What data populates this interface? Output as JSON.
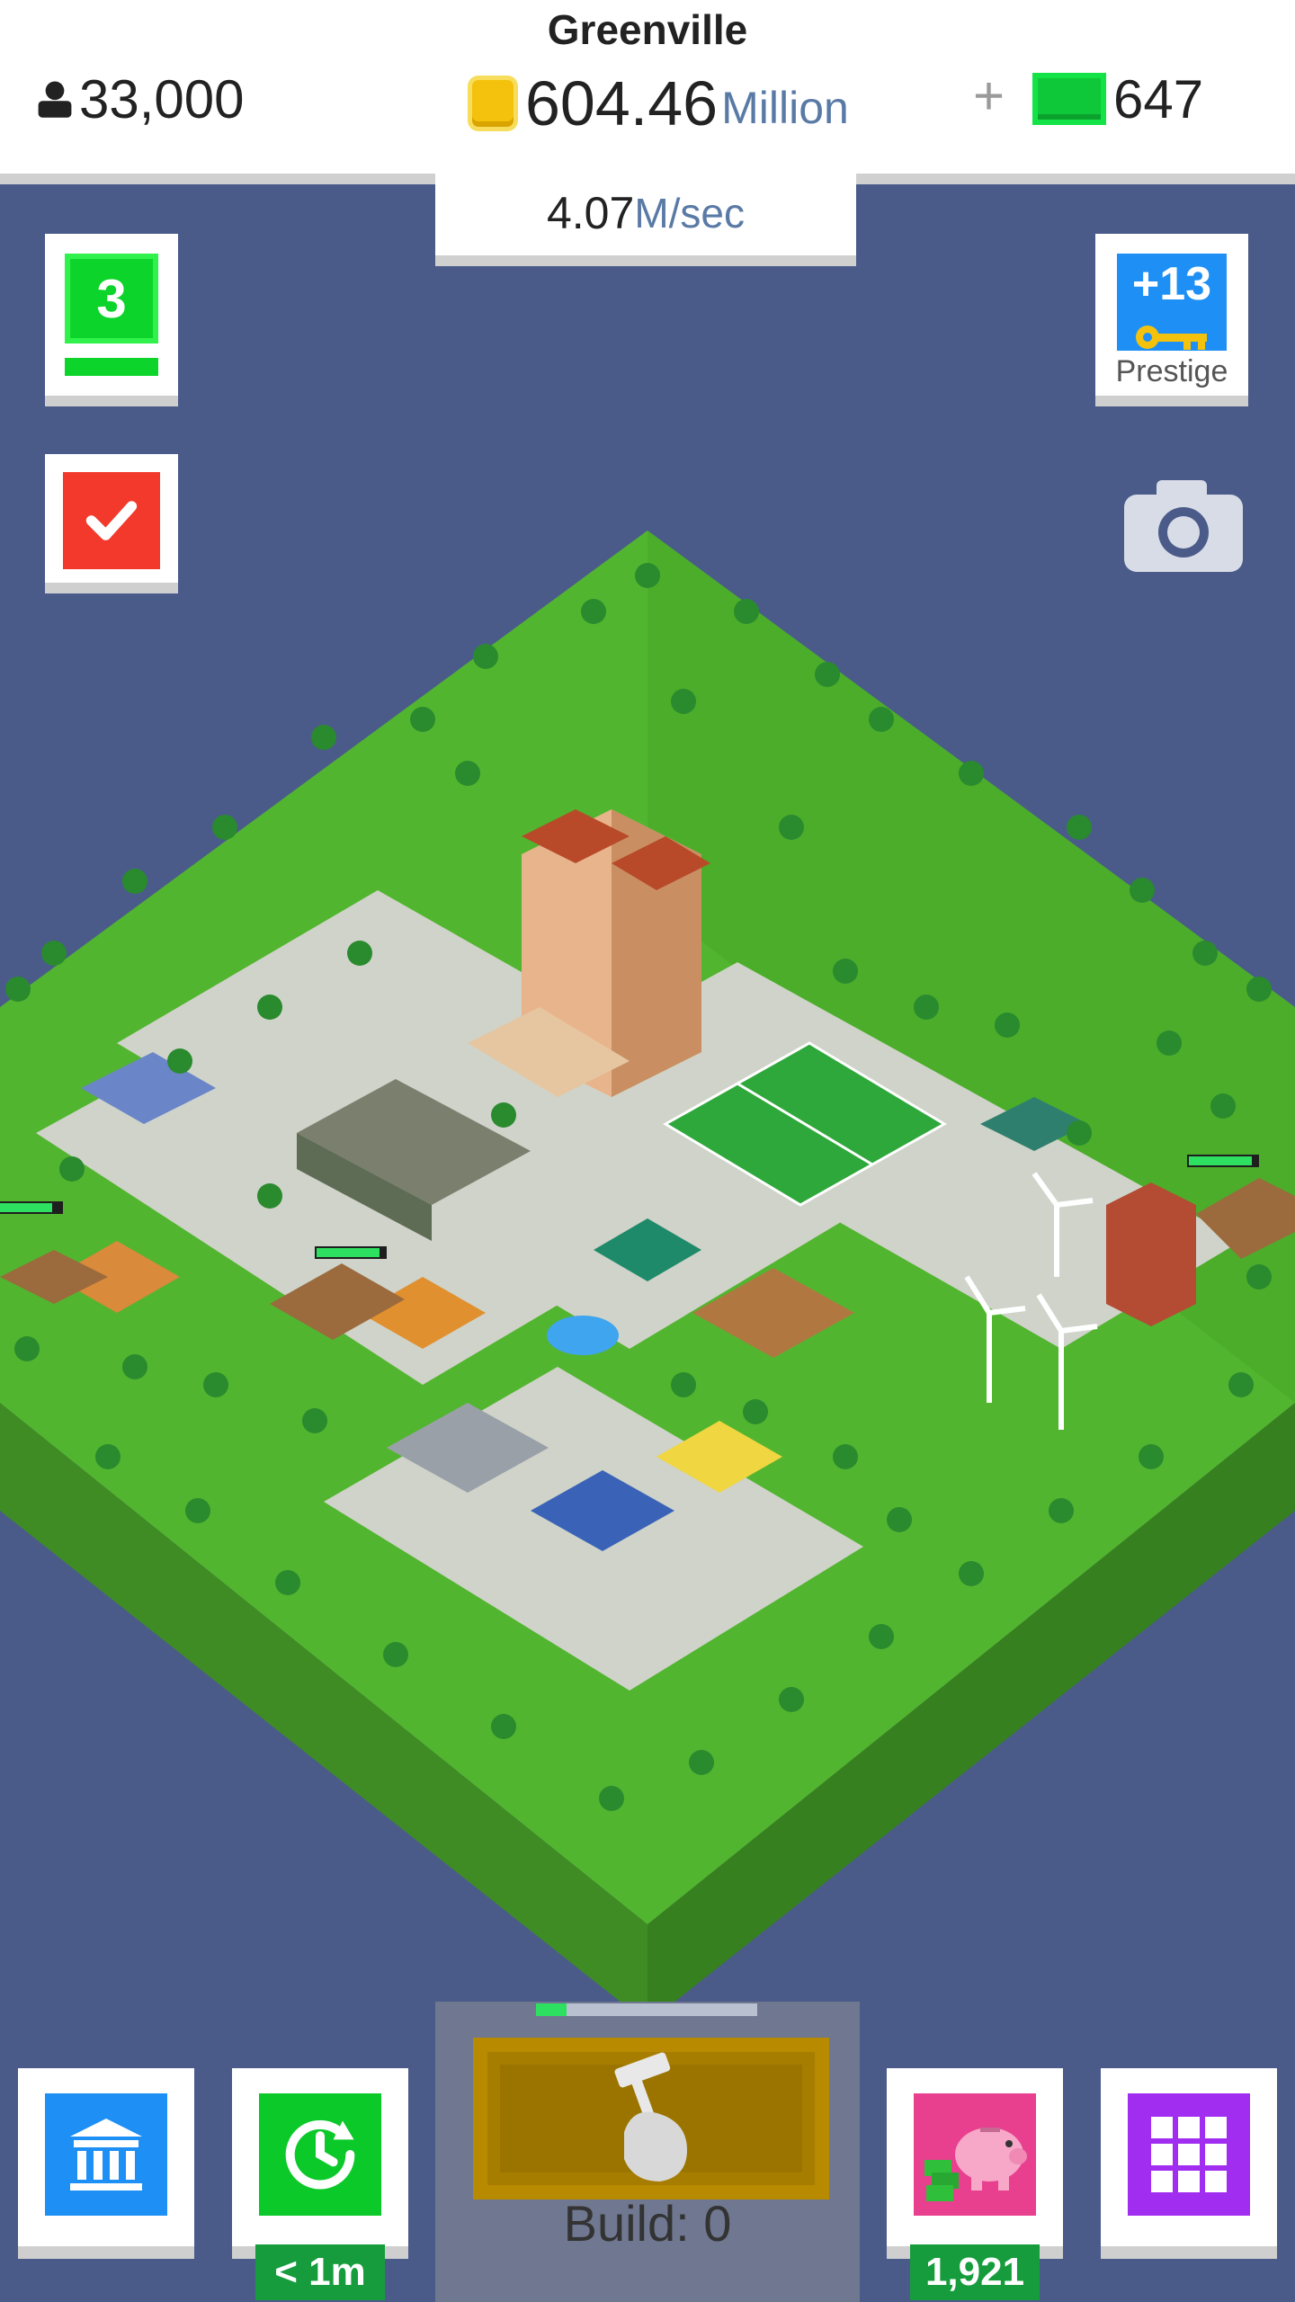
{
  "header": {
    "city_name": "Greenville",
    "population": "33,000",
    "coins_value": "604.46",
    "coins_unit": "Million",
    "plus": "+",
    "cash": "647",
    "rate_value": "4.07",
    "rate_unit": "M/sec"
  },
  "side": {
    "level": "3",
    "prestige_value": "+13",
    "prestige_label": "Prestige"
  },
  "bottom": {
    "time_tag": "< 1m",
    "piggy_tag": "1,921",
    "build_label": "Build: 0",
    "build_progress": 0.14
  },
  "colors": {
    "background": "#4a5b8a",
    "grass": "#4fb12f",
    "coin": "#f4c20d",
    "cash": "#0fc83a",
    "accent_blue": "#1e90f5",
    "accent_red": "#f2392b",
    "accent_purple": "#a12df0",
    "accent_pink": "#e8408f"
  },
  "icons": {
    "population": "person-icon",
    "coin": "coin-icon",
    "cash": "cash-icon",
    "tasks": "checkmark-icon",
    "prestige": "key-icon",
    "camera": "camera-icon",
    "bank": "bank-icon",
    "time": "clock-arrow-icon",
    "piggy": "piggy-bank-icon",
    "grid": "grid-icon",
    "build": "hammer-hand-icon"
  }
}
